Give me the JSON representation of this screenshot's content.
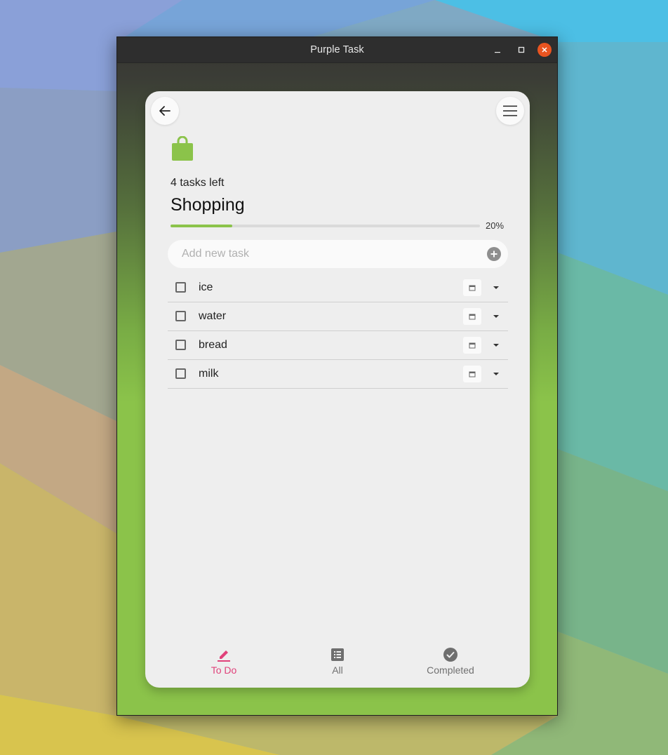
{
  "window": {
    "title": "Purple Task"
  },
  "header": {
    "tasks_left": "4 tasks left",
    "list_title": "Shopping",
    "progress_label": "20%",
    "progress_fraction": 0.2
  },
  "add_task": {
    "placeholder": "Add new task",
    "value": ""
  },
  "tasks": [
    {
      "label": "ice",
      "done": false
    },
    {
      "label": "water",
      "done": false
    },
    {
      "label": "bread",
      "done": false
    },
    {
      "label": "milk",
      "done": false
    }
  ],
  "tabs": [
    {
      "label": "To Do",
      "icon": "pencil-icon",
      "active": true
    },
    {
      "label": "All",
      "icon": "list-icon",
      "active": false
    },
    {
      "label": "Completed",
      "icon": "check-circle-icon",
      "active": false
    }
  ],
  "colors": {
    "accent_green": "#8bc34a",
    "active_tab": "#e0417a",
    "close_button": "#e95420"
  }
}
